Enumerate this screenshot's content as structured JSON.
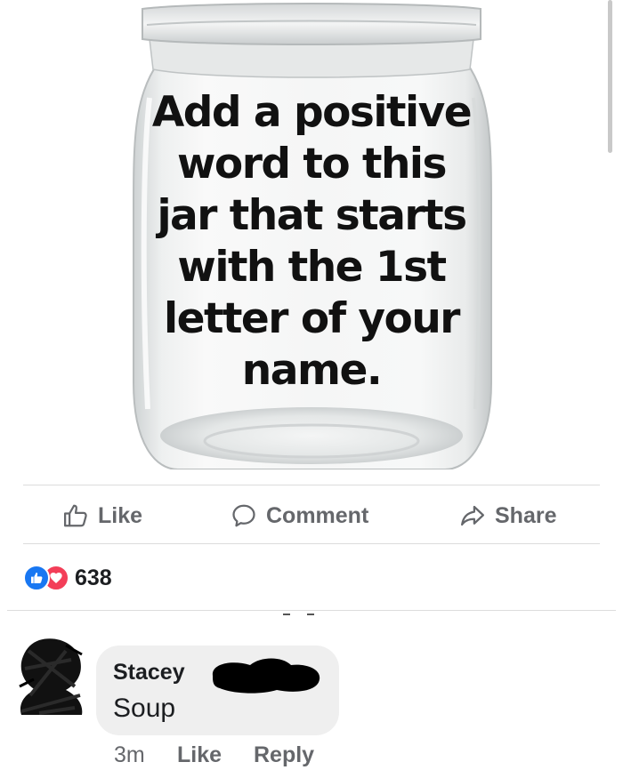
{
  "post": {
    "image_text": "Add a positive\nword to this\njar that starts\nwith the 1st\nletter of your\nname."
  },
  "actions": {
    "like_label": "Like",
    "comment_label": "Comment",
    "share_label": "Share"
  },
  "reactions": {
    "count": "638",
    "icons": [
      "like-icon",
      "love-icon"
    ]
  },
  "comment": {
    "author": "Stacey",
    "text": "Soup",
    "time": "3m",
    "like_label": "Like",
    "reply_label": "Reply"
  },
  "colors": {
    "action_text": "#65676b",
    "like_blue": "#1877f2",
    "love_red": "#f33e58",
    "bubble": "#efefef"
  }
}
